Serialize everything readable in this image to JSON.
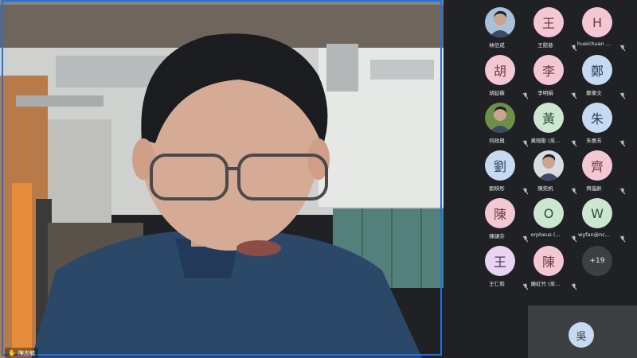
{
  "speaker": {
    "name": "陳志毓",
    "hand_icon": "raised-hand-icon"
  },
  "participants": [
    {
      "label": "林信成",
      "avatar_text": "",
      "photo": true,
      "bg": "#a8c0d8",
      "muted": false
    },
    {
      "label": "王慰慈",
      "avatar_text": "王",
      "bg": "#f4c7d4",
      "fg": "#6b3a47",
      "muted": true
    },
    {
      "label": "hueichuan ...",
      "avatar_text": "H",
      "bg": "#f4c7d4",
      "fg": "#6b3a47",
      "muted": true
    },
    {
      "label": "胡延薇",
      "avatar_text": "胡",
      "bg": "#f4c7d4",
      "fg": "#6b3a47",
      "muted": true
    },
    {
      "label": "李明娟",
      "avatar_text": "李",
      "bg": "#f4c7d4",
      "fg": "#6b3a47",
      "muted": true
    },
    {
      "label": "鄭東文",
      "avatar_text": "鄭",
      "bg": "#c6dbf2",
      "fg": "#2a3f55",
      "muted": true
    },
    {
      "label": "何政興",
      "avatar_text": "",
      "photo": true,
      "bg": "#6c8f4a",
      "muted": true
    },
    {
      "label": "黃翔聖 (來...",
      "avatar_text": "黃",
      "bg": "#cde6d2",
      "fg": "#2f4f36",
      "muted": true
    },
    {
      "label": "朱惠芳",
      "avatar_text": "朱",
      "bg": "#c6dbf2",
      "fg": "#2a3f55",
      "muted": true
    },
    {
      "label": "劉映彤",
      "avatar_text": "劉",
      "bg": "#c6dbf2",
      "fg": "#2a3f55",
      "muted": true
    },
    {
      "label": "陳奕帆",
      "avatar_text": "",
      "photo": true,
      "bg": "#d8dde3",
      "muted": true
    },
    {
      "label": "齊嵐齡",
      "avatar_text": "齊",
      "bg": "#f4c7d4",
      "fg": "#6b3a47",
      "muted": true
    },
    {
      "label": "陳韻芬",
      "avatar_text": "陳",
      "bg": "#f4c7d4",
      "fg": "#6b3a47",
      "muted": true
    },
    {
      "label": "orpheus (...",
      "avatar_text": "O",
      "bg": "#cde6d2",
      "fg": "#2f4f36",
      "muted": true
    },
    {
      "label": "wyfan@nc...",
      "avatar_text": "W",
      "bg": "#cde6d2",
      "fg": "#2f4f36",
      "muted": true
    },
    {
      "label": "王仁和",
      "avatar_text": "王",
      "bg": "#e8d5f2",
      "fg": "#4a3557",
      "muted": true
    },
    {
      "label": "陳虹竹 (來...",
      "avatar_text": "陳",
      "bg": "#f4c7d4",
      "fg": "#6b3a47",
      "muted": true
    },
    {
      "label": "",
      "avatar_text": "+19",
      "more": true,
      "muted": false
    }
  ],
  "self_view": {
    "avatar_text": "吳"
  }
}
